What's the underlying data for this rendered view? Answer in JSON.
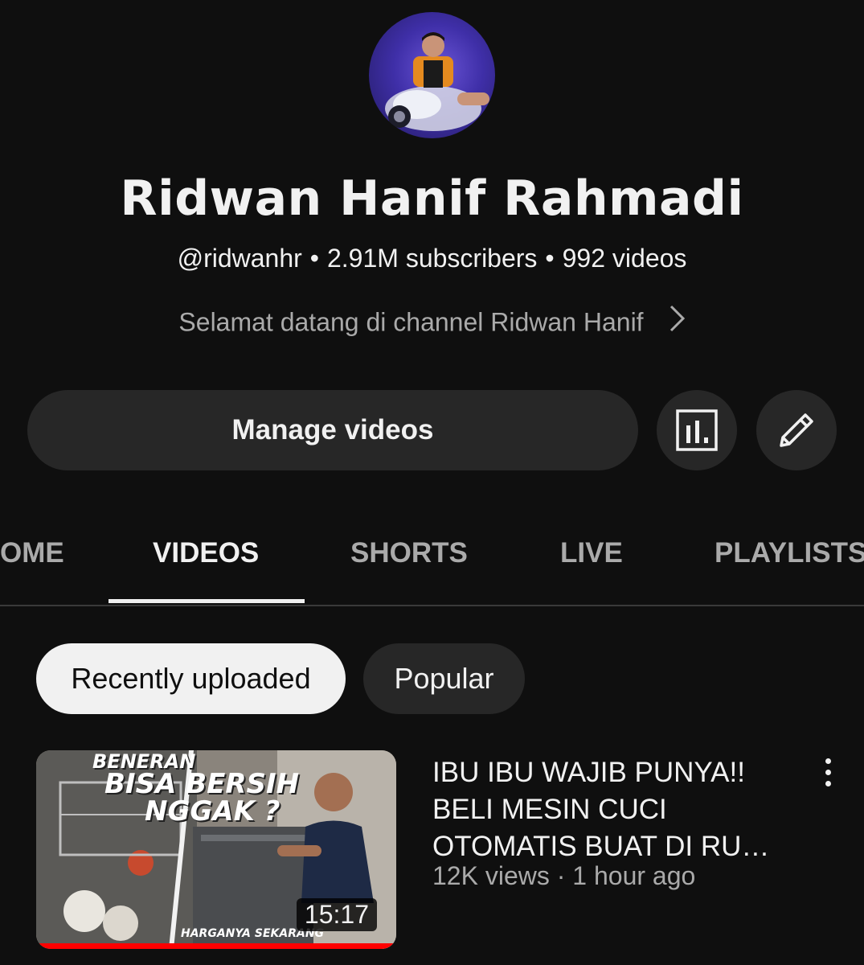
{
  "channel": {
    "name": "Ridwan Hanif Rahmadi",
    "handle": "@ridwanhr",
    "subscribers": "2.91M subscribers",
    "videos": "992 videos",
    "description": "Selamat datang di channel Ridwan Hanif"
  },
  "actions": {
    "manage_label": "Manage videos",
    "analytics_icon": "bar-chart-icon",
    "edit_icon": "pencil-icon"
  },
  "tabs": [
    {
      "label": "OME",
      "active": false
    },
    {
      "label": "VIDEOS",
      "active": true
    },
    {
      "label": "SHORTS",
      "active": false
    },
    {
      "label": "LIVE",
      "active": false
    },
    {
      "label": "PLAYLISTS",
      "active": false
    }
  ],
  "chips": [
    {
      "label": "Recently uploaded",
      "selected": true
    },
    {
      "label": "Popular",
      "selected": false
    }
  ],
  "videos": [
    {
      "title": "IBU IBU WAJIB PUNYA!! BELI MESIN CUCI OTOMATIS BUAT DI RU…",
      "meta": "12K views · 1 hour ago",
      "duration": "15:17",
      "thumb_text_1": "BENERAN",
      "thumb_text_2": "BISA BERSIH",
      "thumb_text_3": "NGGAK ?",
      "thumb_caption": "HARGANYA SEKARANG",
      "watch_progress": 1.0
    }
  ],
  "colors": {
    "background": "#0f0f0f",
    "surface": "#272727",
    "text": "#f1f1f1",
    "secondary_text": "#aaaaaa",
    "progress": "#ff0000"
  }
}
